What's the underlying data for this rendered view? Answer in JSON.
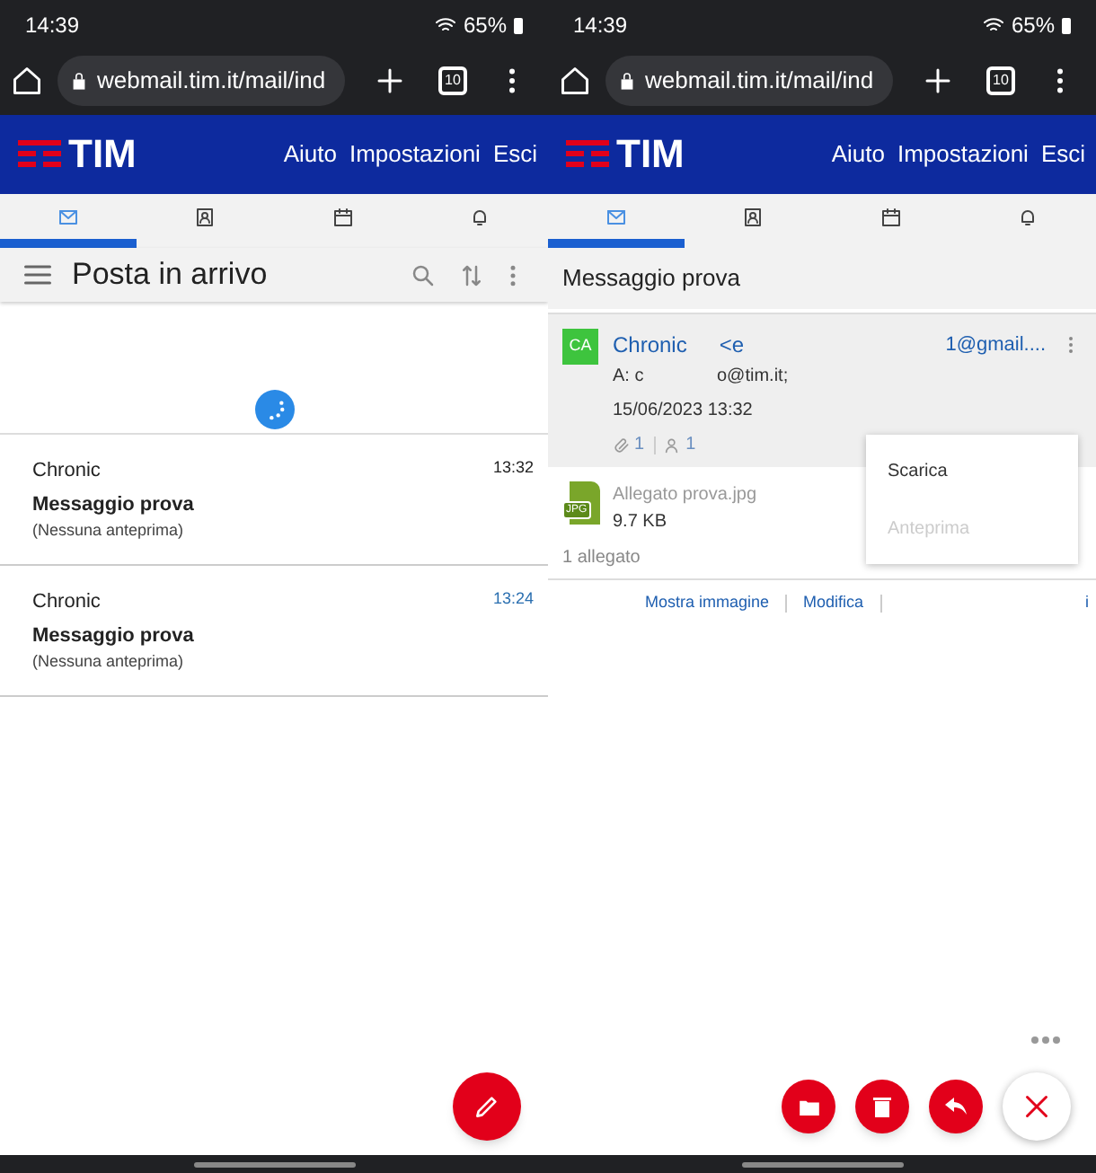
{
  "screens": [
    {
      "kind": "inbox",
      "status_bar": {
        "time": "14:39",
        "battery": "65%"
      },
      "browser": {
        "url": "webmail.tim.it/mail/ind",
        "tab_count": "10"
      },
      "header": {
        "logo": "TIM",
        "links": [
          "Aiuto",
          "Impostazioni",
          "Esci"
        ]
      },
      "tabs": [
        {
          "selected": true
        },
        {
          "selected": false
        },
        {
          "selected": false
        },
        {
          "selected": false
        }
      ],
      "title": "Posta in arrivo",
      "loading": true,
      "messages": [
        {
          "sender": "Chronic",
          "subject": "Messaggio prova",
          "preview": "(Nessuna anteprima)",
          "time": "13:32",
          "highlighted": false
        },
        {
          "sender": "Chronic",
          "subject": "Messaggio prova",
          "preview": "(Nessuna anteprima)",
          "time": "13:24",
          "highlighted": true
        }
      ]
    },
    {
      "kind": "message",
      "status_bar": {
        "time": "14:39",
        "battery": "65%"
      },
      "browser": {
        "url": "webmail.tim.it/mail/ind",
        "tab_count": "10"
      },
      "header": {
        "logo": "TIM",
        "links": [
          "Aiuto",
          "Impostazioni",
          "Esci"
        ]
      },
      "tabs": [
        {
          "selected": true
        },
        {
          "selected": false
        },
        {
          "selected": false
        },
        {
          "selected": false
        }
      ],
      "title": "Messaggio prova",
      "message": {
        "avatar": "CA",
        "sender": "Chronic",
        "sender_address_start": "<e",
        "sender_address_end": "1@gmail....",
        "to_label": "A: c",
        "to_address_end": "o@tim.it;",
        "date": "15/06/2023 13:32",
        "attachment_count": "1",
        "recipient_count": "1"
      },
      "attachment": {
        "name": "Allegato prova.jpg",
        "size": "9.7 KB",
        "file_type": "JPG",
        "footer": "1 allegato"
      },
      "actions": [
        "Mostra immagine",
        "Modifica",
        "i"
      ],
      "menu": [
        {
          "label": "Scarica",
          "disabled": false
        },
        {
          "label": "Anteprima",
          "disabled": true
        }
      ]
    }
  ]
}
